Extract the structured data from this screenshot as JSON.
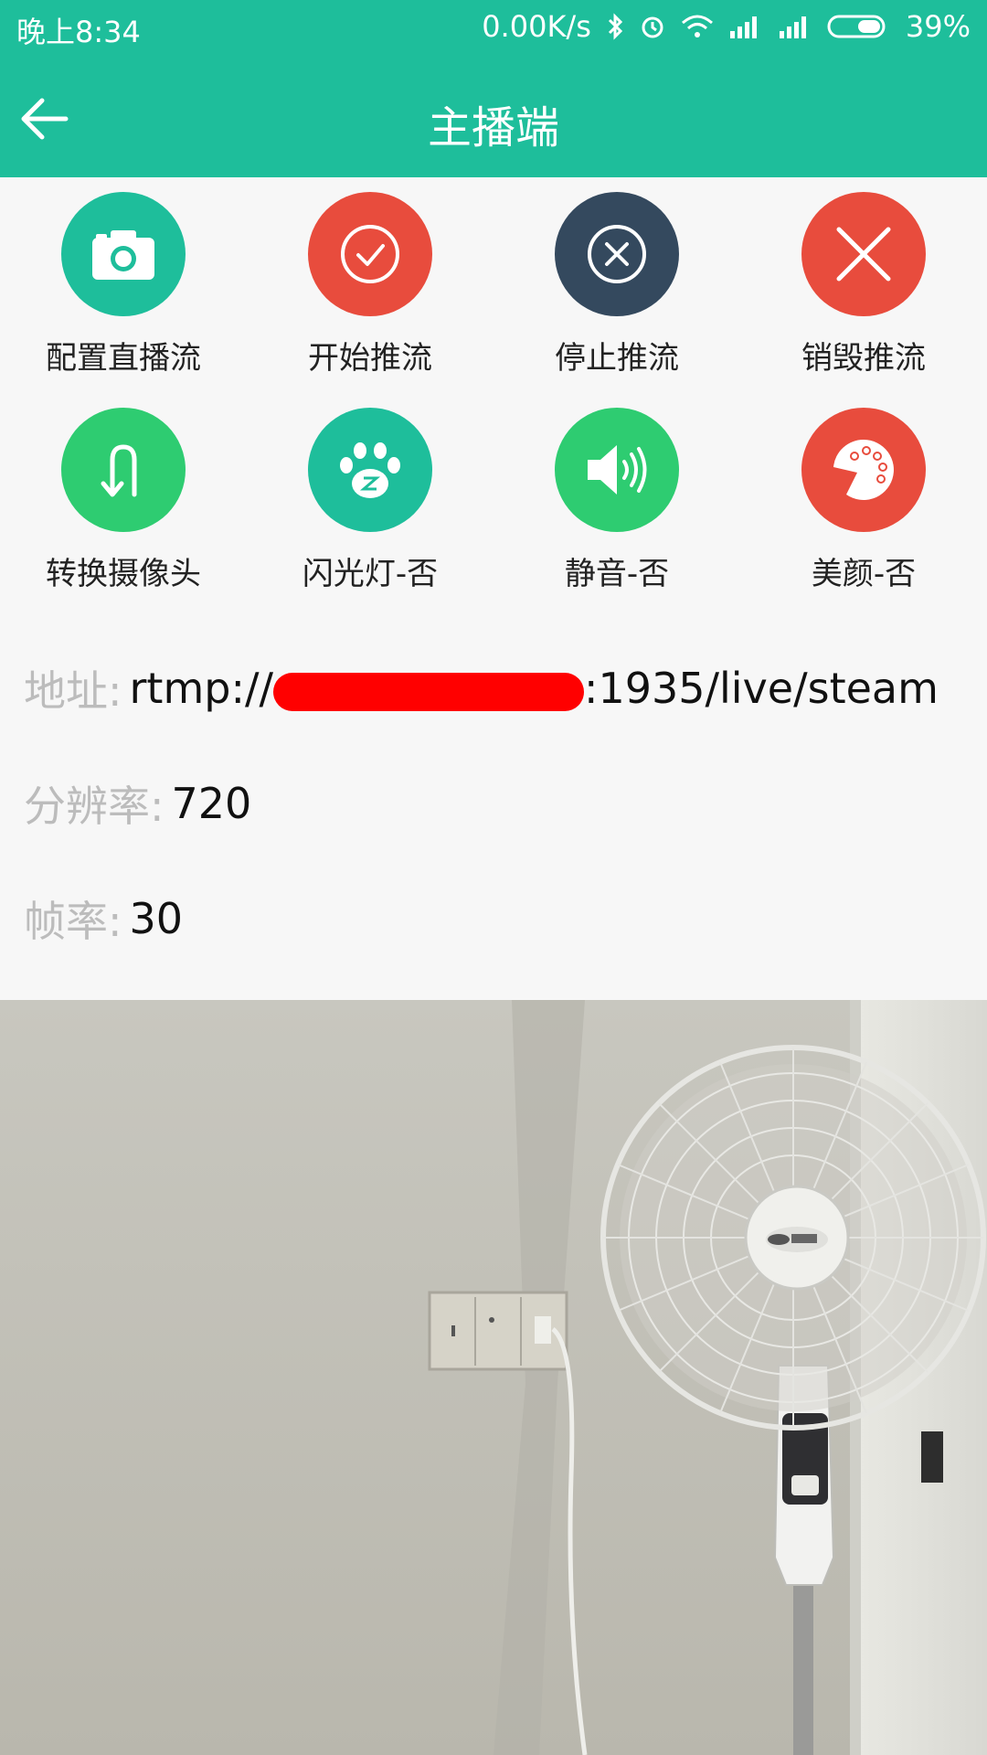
{
  "status_bar": {
    "time": "晚上8:34",
    "speed": "0.00K/s",
    "battery": "39%"
  },
  "app_bar": {
    "title": "主播端",
    "back_icon": "arrow-left-icon"
  },
  "actions": [
    {
      "label": "配置直播流",
      "icon": "camera-icon",
      "color": "#1ebe9b"
    },
    {
      "label": "开始推流",
      "icon": "check-circle-icon",
      "color": "#e84c3d"
    },
    {
      "label": "停止推流",
      "icon": "x-circle-icon",
      "color": "#34495e"
    },
    {
      "label": "销毁推流",
      "icon": "close-icon",
      "color": "#e84c3d"
    },
    {
      "label": "转换摄像头",
      "icon": "u-turn-icon",
      "color": "#2ecc71"
    },
    {
      "label": "闪光灯-否",
      "icon": "paw-icon",
      "color": "#1ebe9b"
    },
    {
      "label": "静音-否",
      "icon": "speaker-icon",
      "color": "#2ecc71"
    },
    {
      "label": "美颜-否",
      "icon": "palette-icon",
      "color": "#e84c3d"
    }
  ],
  "info": {
    "address_key": "地址:",
    "address_prefix": "rtmp://",
    "address_suffix": ":1935/live/steam",
    "resolution_key": "分辨率:",
    "resolution_val": "720",
    "fps_key": "帧率:",
    "fps_val": "30"
  },
  "colors": {
    "primary": "#1ebe9b",
    "red": "#e84c3d",
    "dark": "#34495e",
    "green": "#2ecc71"
  }
}
